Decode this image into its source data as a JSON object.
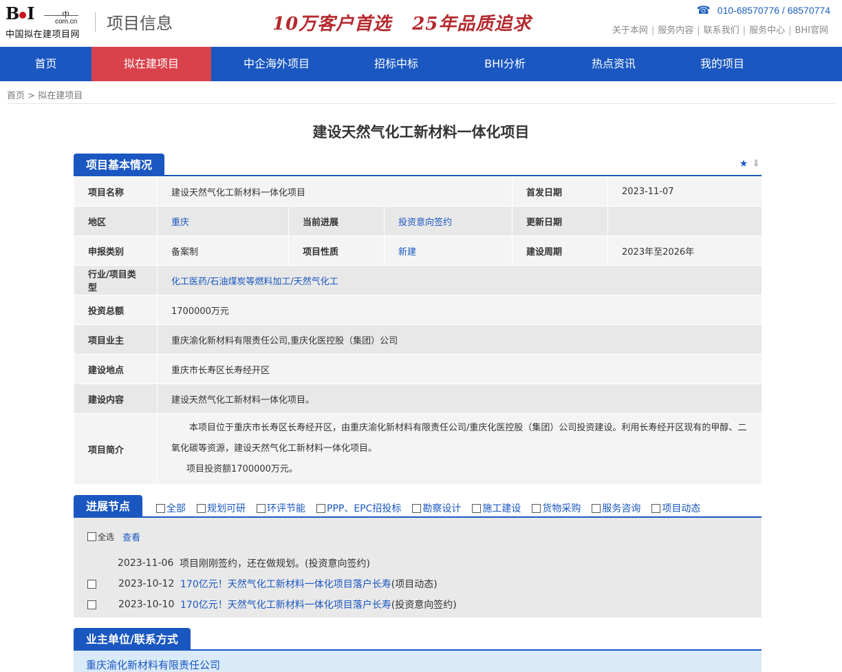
{
  "header": {
    "logo_text": "BHI",
    "logo_domain": "com.cn",
    "logo_zh": "中",
    "logo_sub": "中国拟在建项目网",
    "section_name": "项目信息",
    "slogan_left": "10万客户首选",
    "slogan_right": "25年品质追求",
    "phone": "010-68570776 / 68570774",
    "top_links": [
      "关于本网",
      "服务内容",
      "联系我们",
      "服务中心",
      "BHI官网"
    ]
  },
  "nav": [
    "首页",
    "拟在建项目",
    "中企海外项目",
    "招标中标",
    "BHI分析",
    "热点资讯",
    "我的项目"
  ],
  "nav_active": "拟在建项目",
  "breadcrumb": {
    "home": "首页",
    "sep": ">",
    "current": "拟在建项目"
  },
  "title": "建设天然气化工新材料一体化项目",
  "basic": {
    "heading": "项目基本情况",
    "project_name_label": "项目名称",
    "project_name": "建设天然气化工新材料一体化项目",
    "first_date_label": "首发日期",
    "first_date": "2023-11-07",
    "region_label": "地区",
    "region": "重庆",
    "stage_label": "当前进展",
    "stage": "投资意向签约",
    "update_label": "更新日期",
    "update": "",
    "category_label": "申报类别",
    "category": "备案制",
    "nature_label": "项目性质",
    "nature": "新建",
    "period_label": "建设周期",
    "period": "2023年至2026年",
    "industry_label": "行业/项目类型",
    "industry": "化工医药/石油煤炭等燃料加工/天然气化工",
    "investment_label": "投资总额",
    "investment": "1700000万元",
    "owner_label": "项目业主",
    "owner": "重庆渝化新材料有限责任公司,重庆化医控股（集团）公司",
    "location_label": "建设地点",
    "location": "重庆市长寿区长寿经开区",
    "content_label": "建设内容",
    "content": "建设天然气化工新材料一体化项目。",
    "intro_label": "项目简介",
    "intro_p1": "本项目位于重庆市长寿区长寿经开区，由重庆渝化新材料有限责任公司/重庆化医控股（集团）公司投资建设。利用长寿经开区现有的甲醇、二氧化碳等资源，建设天然气化工新材料一体化项目。",
    "intro_p2": "项目投资额1700000万元。"
  },
  "progress": {
    "heading": "进展节点",
    "filters": [
      "全部",
      "规划可研",
      "环评节能",
      "PPP、EPC招投标",
      "勘察设计",
      "施工建设",
      "货物采购",
      "服务咨询",
      "项目动态"
    ],
    "select_all": "全选",
    "view": "查看",
    "items": [
      {
        "date": "2023-11-06",
        "text": "项目刚刚签约，还在做规划。(投资意向签约)"
      },
      {
        "date": "2023-10-12",
        "title": "170亿元！天然气化工新材料一体化项目落户长寿",
        "tag": "(项目动态)"
      },
      {
        "date": "2023-10-10",
        "title": "170亿元！天然气化工新材料一体化项目落户长寿",
        "tag": "(投资意向签约)"
      }
    ]
  },
  "owner_section": {
    "heading": "业主单位/联系方式",
    "company": "重庆渝化新材料有限责任公司"
  }
}
